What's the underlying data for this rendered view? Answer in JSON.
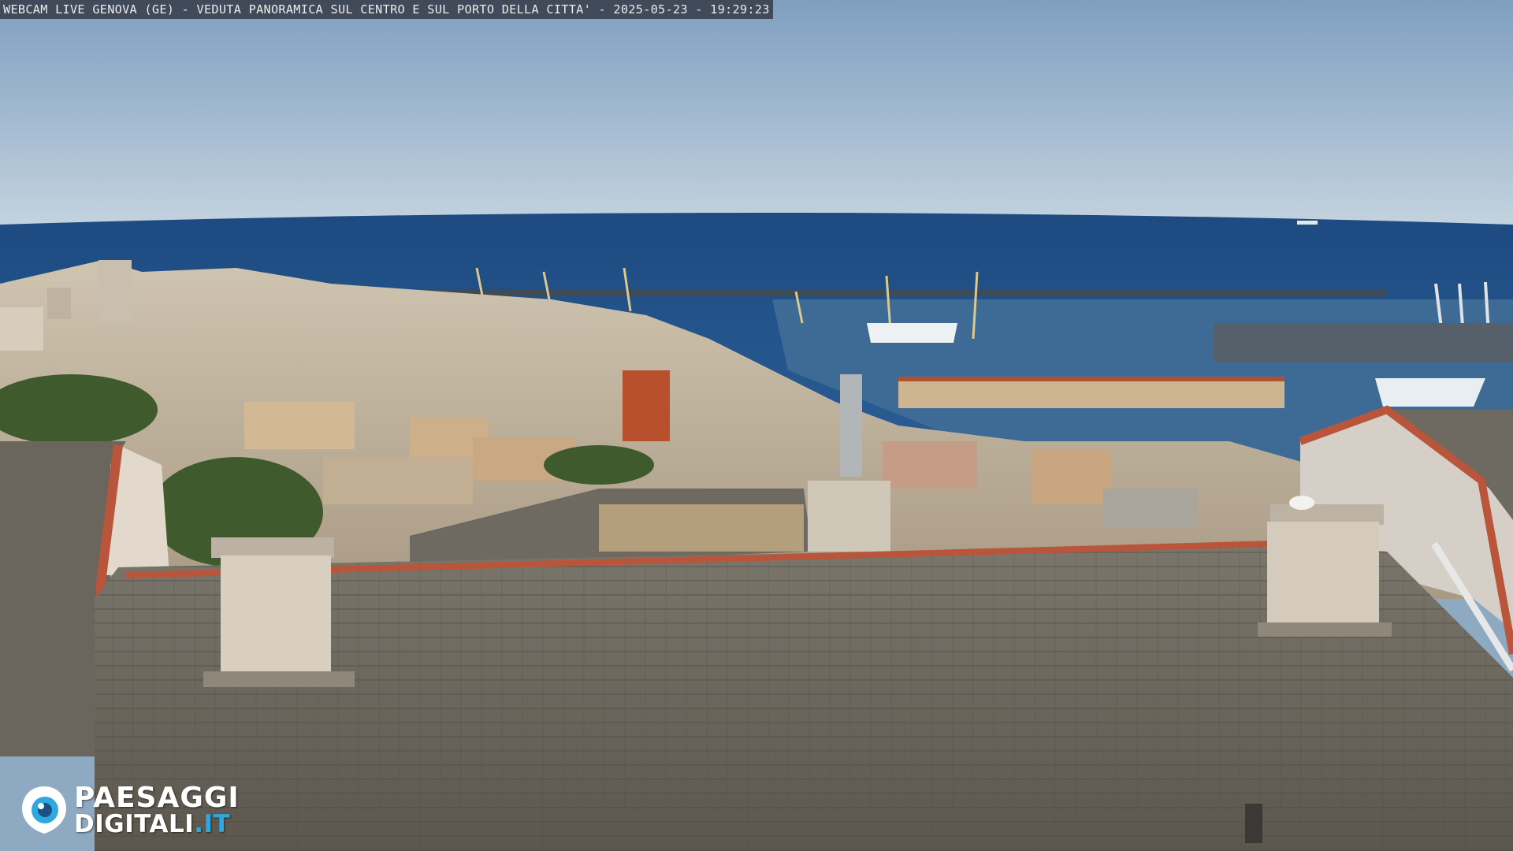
{
  "overlay": {
    "caption": "WEBCAM LIVE GENOVA (GE) - VEDUTA PANORAMICA SUL CENTRO E SUL PORTO DELLA CITTA' - 2025-05-23 - 19:29:23"
  },
  "logo": {
    "line1": "PAESAGGI",
    "line2_main": "DIGITALI",
    "line2_suffix": ".IT",
    "icon": "eye-icon",
    "accent_color": "#2fa8e0"
  },
  "scene": {
    "sky_top_color": "#7f9fc0",
    "sky_horizon_color": "#c4d3df",
    "sea_color": "#1f4f86",
    "roof_color": "#6f6a60",
    "gutter_color": "#b8553a"
  }
}
